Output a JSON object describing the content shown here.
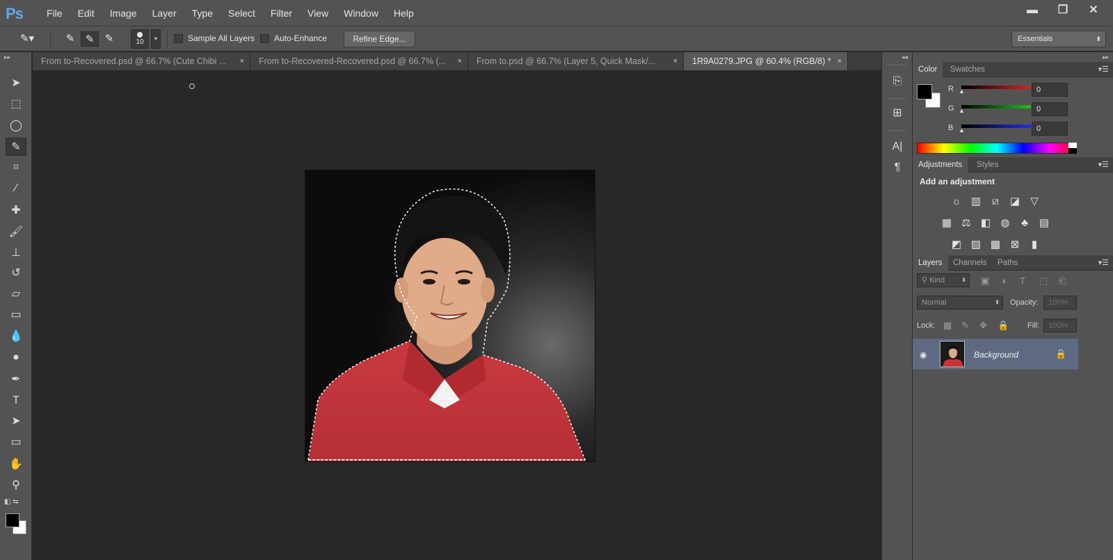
{
  "app": {
    "logo": "Ps"
  },
  "menu": [
    "File",
    "Edit",
    "Image",
    "Layer",
    "Type",
    "Select",
    "Filter",
    "View",
    "Window",
    "Help"
  ],
  "window_controls": {
    "minimize": "▬",
    "restore": "❐",
    "close": "✕"
  },
  "options_bar": {
    "brush_size": "10",
    "sample_all_layers": "Sample All Layers",
    "auto_enhance": "Auto-Enhance",
    "refine_edge": "Refine Edge...",
    "workspace": "Essentials"
  },
  "tabs": [
    {
      "label": "From to-Recovered.psd @ 66.7% (Cute Chibi ...",
      "close": "×"
    },
    {
      "label": "From to-Recovered-Recovered.psd @ 66.7% (...",
      "close": "×"
    },
    {
      "label": "From to.psd @ 66.7% (Layer 5, Quick Mask/...",
      "close": "×"
    },
    {
      "label": "1R9A0279.JPG @ 60.4% (RGB/8) *",
      "close": "×"
    }
  ],
  "color_panel": {
    "tabs": [
      "Color",
      "Swatches"
    ],
    "channels": [
      {
        "label": "R",
        "value": "0",
        "color": "#e02020"
      },
      {
        "label": "G",
        "value": "0",
        "color": "#20c020"
      },
      {
        "label": "B",
        "value": "0",
        "color": "#2030e0"
      }
    ]
  },
  "adjustments_panel": {
    "tabs": [
      "Adjustments",
      "Styles"
    ],
    "title": "Add an adjustment"
  },
  "layers_panel": {
    "tabs": [
      "Layers",
      "Channels",
      "Paths"
    ],
    "filter_kind": "Kind",
    "blend_mode": "Normal",
    "opacity_label": "Opacity:",
    "opacity_value": "100%",
    "lock_label": "Lock:",
    "fill_label": "Fill:",
    "fill_value": "100%",
    "layers": [
      {
        "name": "Background",
        "visible": true,
        "locked": true
      }
    ]
  },
  "colors": {
    "selection_accent": "#5d6a82",
    "ps_logo": "#5fa8e8",
    "shirt_red": "#c8333a"
  }
}
